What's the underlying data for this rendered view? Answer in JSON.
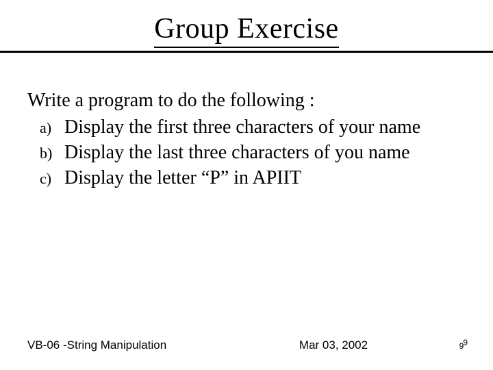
{
  "title": "Group Exercise",
  "intro": "Write a program to do the following :",
  "items": [
    {
      "marker": "a)",
      "text": "Display the first three characters of your name"
    },
    {
      "marker": "b)",
      "text": "Display the last three characters of you name"
    },
    {
      "marker": "c)",
      "text": "Display the letter “P” in APIIT"
    }
  ],
  "footer": {
    "left": "VB-06 -String Manipulation",
    "center": "Mar 03, 2002",
    "page_small": "9",
    "page_sup": "9"
  }
}
